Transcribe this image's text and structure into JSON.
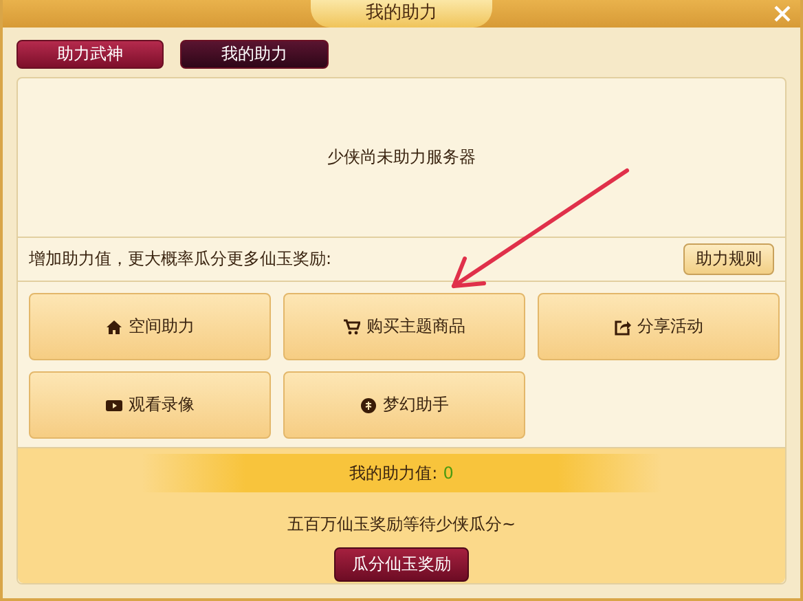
{
  "window": {
    "title": "我的助力"
  },
  "tabs": [
    {
      "label": "助力武神",
      "selected": false
    },
    {
      "label": "我的助力",
      "selected": true
    }
  ],
  "status_message": "少侠尚未助力服务器",
  "hint": "增加助力值，更大概率瓜分更多仙玉奖励:",
  "rules_button": "助力规则",
  "actions": [
    {
      "label": "空间助力",
      "kind": "home"
    },
    {
      "label": "购买主题商品",
      "kind": "cart"
    },
    {
      "label": "分享活动",
      "kind": "share"
    },
    {
      "label": "观看录像",
      "kind": "video"
    },
    {
      "label": "梦幻助手",
      "kind": "assistant"
    }
  ],
  "my_value": {
    "label": "我的助力值:",
    "value": "0"
  },
  "reward_message": "五百万仙玉奖励等待少侠瓜分~",
  "claim_button": "瓜分仙玉奖励"
}
